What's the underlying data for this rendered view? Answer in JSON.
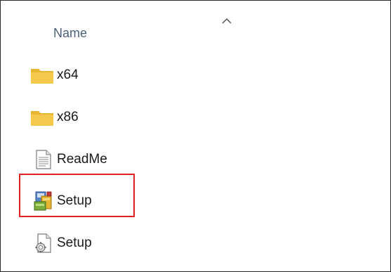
{
  "header": {
    "column_name": "Name",
    "sort_indicator_icon": "chevron-up-icon"
  },
  "files": [
    {
      "name": "x64",
      "icon": "folder-icon",
      "type": "folder"
    },
    {
      "name": "x86",
      "icon": "folder-icon",
      "type": "folder"
    },
    {
      "name": "ReadMe",
      "icon": "text-file-icon",
      "type": "text"
    },
    {
      "name": "Setup",
      "icon": "setup-installer-icon",
      "type": "application"
    },
    {
      "name": "Setup",
      "icon": "config-file-icon",
      "type": "config"
    }
  ],
  "highlight": {
    "target": "Setup (application)",
    "color": "#e02020"
  },
  "colors": {
    "folder": "#f4c84a",
    "header_text": "#4c607a",
    "text": "#1a1a1a"
  }
}
